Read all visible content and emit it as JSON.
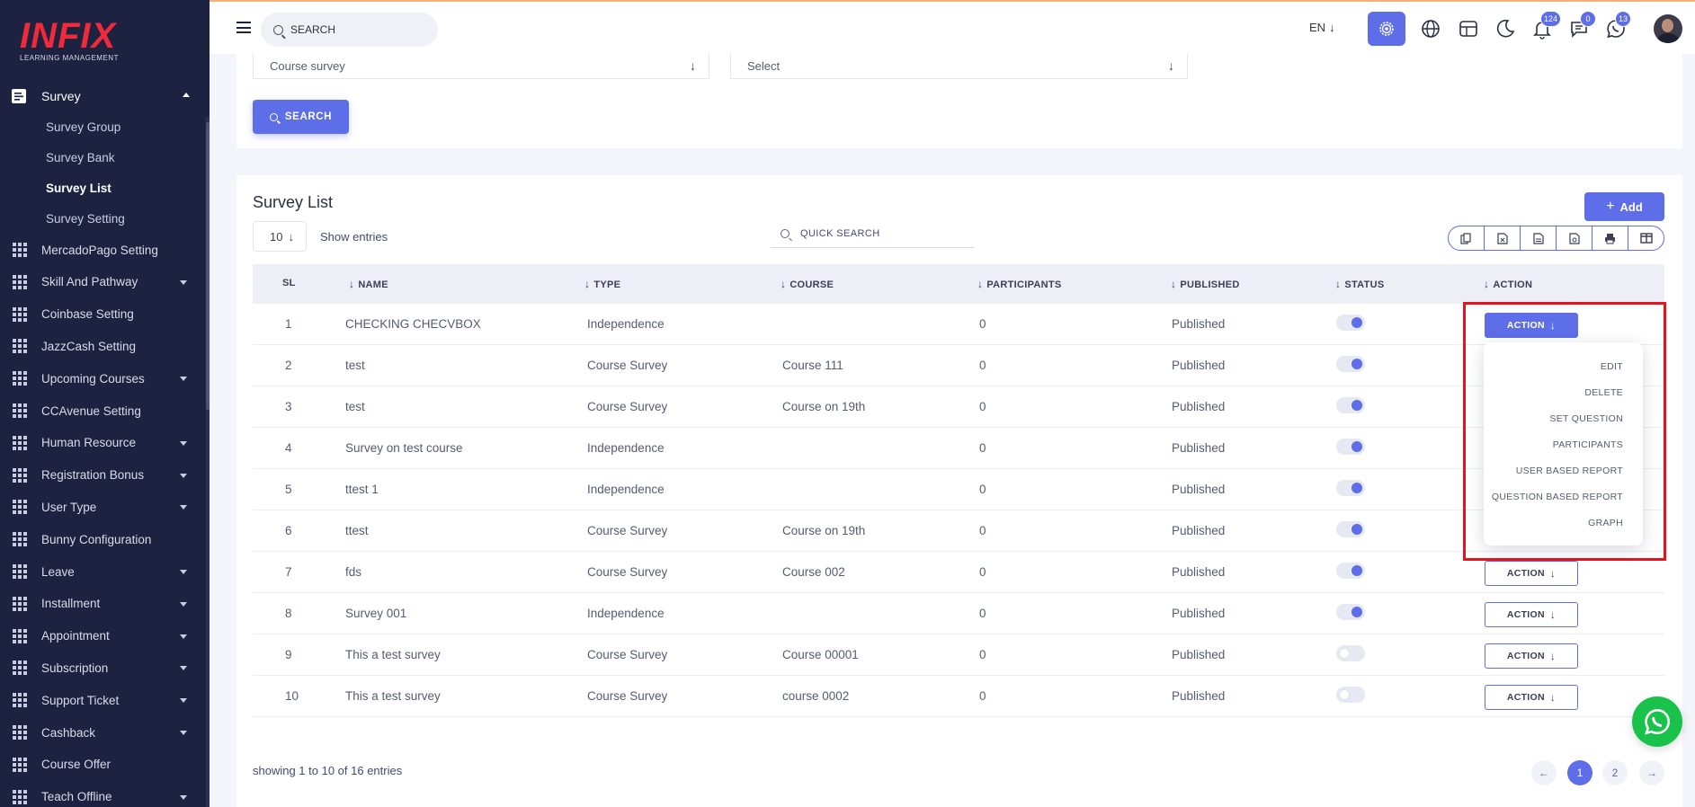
{
  "brand": {
    "logo_text": "INFIX",
    "tagline": "LEARNING MANAGEMENT"
  },
  "sidebar": {
    "survey": {
      "label": "Survey",
      "items": [
        {
          "label": "Survey Group",
          "active": false
        },
        {
          "label": "Survey Bank",
          "active": false
        },
        {
          "label": "Survey List",
          "active": true
        },
        {
          "label": "Survey Setting",
          "active": false
        }
      ]
    },
    "menu": [
      {
        "label": "MercadoPago Setting",
        "has_caret": false
      },
      {
        "label": "Skill And Pathway",
        "has_caret": true
      },
      {
        "label": "Coinbase Setting",
        "has_caret": false
      },
      {
        "label": "JazzCash Setting",
        "has_caret": false
      },
      {
        "label": "Upcoming Courses",
        "has_caret": true
      },
      {
        "label": "CCAvenue Setting",
        "has_caret": false
      },
      {
        "label": "Human Resource",
        "has_caret": true
      },
      {
        "label": "Registration Bonus",
        "has_caret": true
      },
      {
        "label": "User Type",
        "has_caret": true
      },
      {
        "label": "Bunny Configuration",
        "has_caret": false
      },
      {
        "label": "Leave",
        "has_caret": true
      },
      {
        "label": "Installment",
        "has_caret": true
      },
      {
        "label": "Appointment",
        "has_caret": true
      },
      {
        "label": "Subscription",
        "has_caret": true
      },
      {
        "label": "Support Ticket",
        "has_caret": true
      },
      {
        "label": "Cashback",
        "has_caret": true
      },
      {
        "label": "Course Offer",
        "has_caret": false
      },
      {
        "label": "Teach Offline",
        "has_caret": true
      }
    ]
  },
  "topbar": {
    "search_placeholder": "SEARCH",
    "language": "EN",
    "notifications_count": "124",
    "messages_count": "0",
    "whatsapp_count": "13"
  },
  "filters": {
    "survey_type_value": "Course survey",
    "second_select_value": "Select",
    "search_label": "SEARCH"
  },
  "list": {
    "title": "Survey List",
    "add_label": "Add",
    "entries_value": "10",
    "show_entries_label": "Show entries",
    "quick_search_placeholder": "QUICK SEARCH",
    "columns": [
      "SL",
      "NAME",
      "TYPE",
      "COURSE",
      "PARTICIPANTS",
      "PUBLISHED",
      "STATUS",
      "ACTION"
    ],
    "action_label": "ACTION",
    "rows": [
      {
        "sl": "1",
        "name": "CHECKING CHECVBOX",
        "type": "Independence",
        "course": "",
        "participants": "0",
        "published": "Published",
        "status_on": true
      },
      {
        "sl": "2",
        "name": "test",
        "type": "Course Survey",
        "course": "Course 111",
        "participants": "0",
        "published": "Published",
        "status_on": true
      },
      {
        "sl": "3",
        "name": "test",
        "type": "Course Survey",
        "course": "Course on 19th",
        "participants": "0",
        "published": "Published",
        "status_on": true
      },
      {
        "sl": "4",
        "name": "Survey on test course",
        "type": "Independence",
        "course": "",
        "participants": "0",
        "published": "Published",
        "status_on": true
      },
      {
        "sl": "5",
        "name": "ttest 1",
        "type": "Independence",
        "course": "",
        "participants": "0",
        "published": "Published",
        "status_on": true
      },
      {
        "sl": "6",
        "name": "ttest",
        "type": "Course Survey",
        "course": "Course on 19th",
        "participants": "0",
        "published": "Published",
        "status_on": true
      },
      {
        "sl": "7",
        "name": "fds",
        "type": "Course Survey",
        "course": "Course 002",
        "participants": "0",
        "published": "Published",
        "status_on": true
      },
      {
        "sl": "8",
        "name": "Survey 001",
        "type": "Independence",
        "course": "",
        "participants": "0",
        "published": "Published",
        "status_on": true
      },
      {
        "sl": "9",
        "name": "This a test survey",
        "type": "Course Survey",
        "course": "Course 00001",
        "participants": "0",
        "published": "Published",
        "status_on": false
      },
      {
        "sl": "10",
        "name": "This a test survey",
        "type": "Course Survey",
        "course": "course 0002",
        "participants": "0",
        "published": "Published",
        "status_on": false
      }
    ],
    "showing_text": "showing 1 to 10 of 16 entries",
    "pages": [
      "1",
      "2"
    ],
    "current_page": "1"
  },
  "action_menu": {
    "items": [
      "EDIT",
      "DELETE",
      "SET QUESTION",
      "PARTICIPANTS",
      "USER BASED REPORT",
      "QUESTION BASED REPORT",
      "GRAPH"
    ]
  },
  "colors": {
    "accent": "#5e6de8",
    "sidebar_bg": "#1c2240",
    "highlight": "#e8121c",
    "whatsapp": "#19c24a"
  }
}
